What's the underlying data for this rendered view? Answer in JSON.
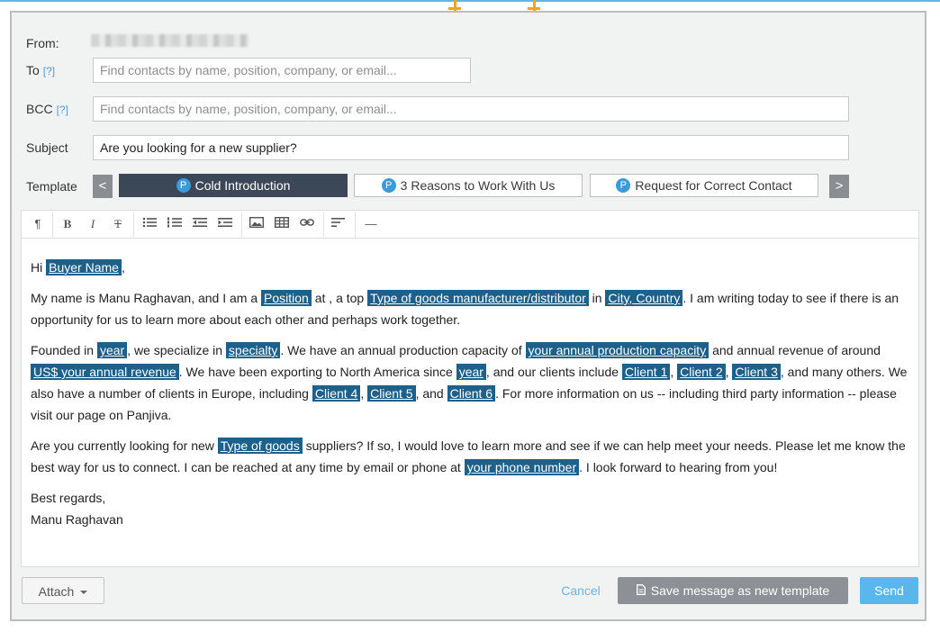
{
  "form": {
    "from_label": "From:",
    "to_label": "To",
    "help_mark": "[?]",
    "to_placeholder": "Find contacts by name, position, company, or email...",
    "bcc_label": "BCC",
    "bcc_placeholder": "Find contacts by name, position, company, or email...",
    "subject_label": "Subject",
    "subject_value": "Are you looking for a new supplier?",
    "template_label": "Template"
  },
  "templates": {
    "prev": "<",
    "next": ">",
    "badge": "P",
    "items": [
      "Cold Introduction",
      "3 Reasons to Work With Us",
      "Request for Correct Contact"
    ],
    "active_index": 0
  },
  "toolbar": {
    "paragraph": "¶",
    "bold": "B",
    "italic": "I",
    "strike": "T",
    "rule": "—"
  },
  "body": {
    "p1": {
      "t1": "Hi ",
      "ph1": "Buyer Name",
      "t2": ","
    },
    "p2": {
      "t1": "My name is Manu Raghavan, and I am a ",
      "ph1": "Position",
      "t2": " at , a top ",
      "ph2": "Type of goods manufacturer/distributor",
      "t3": " in ",
      "ph3": "City, Country",
      "t4": ". I am writing today to see if there is an opportunity for us to learn more about each other and perhaps work together."
    },
    "p3": {
      "t1": "Founded in ",
      "ph1": "year",
      "t2": ", we specialize in ",
      "ph2": "specialty",
      "t3": ". We have an annual production capacity of ",
      "ph3": "your annual production capacity",
      "t4": " and annual revenue of around ",
      "ph4": "US$ your annual revenue",
      "t5": ". We have been exporting to North America since ",
      "ph5": "year",
      "t6": ", and our clients include ",
      "ph6": "Client 1",
      "t7": ", ",
      "ph7": "Client 2",
      "t8": ", ",
      "ph8": "Client 3",
      "t9": ", and many others. We also have a number of clients in Europe, including ",
      "ph9": "Client 4",
      "t10": ", ",
      "ph10": "Client 5",
      "t11": ", and ",
      "ph11": "Client 6",
      "t12": ". For more information on us -- including third party information -- please visit our page on Panjiva."
    },
    "p4": {
      "t1": "Are you currently looking for new ",
      "ph1": "Type of goods",
      "t2": " suppliers? If so, I would love to learn more and see if we can help meet your needs. Please let me know the best way for us to connect. I can be reached at any time by email or phone at ",
      "ph2": "your phone number",
      "t3": ". I look forward to hearing from you!"
    },
    "closing": "Best regards,",
    "signature": "Manu Raghavan"
  },
  "footer": {
    "attach_label": "Attach",
    "cancel_label": "Cancel",
    "save_template_label": "Save message as new template",
    "send_label": "Send"
  },
  "colors": {
    "placeholder_bg": "#1d6089",
    "active_template_bg": "#3c4858",
    "send_bg": "#5ab7ec",
    "badge_bg": "#3b9ad9"
  }
}
